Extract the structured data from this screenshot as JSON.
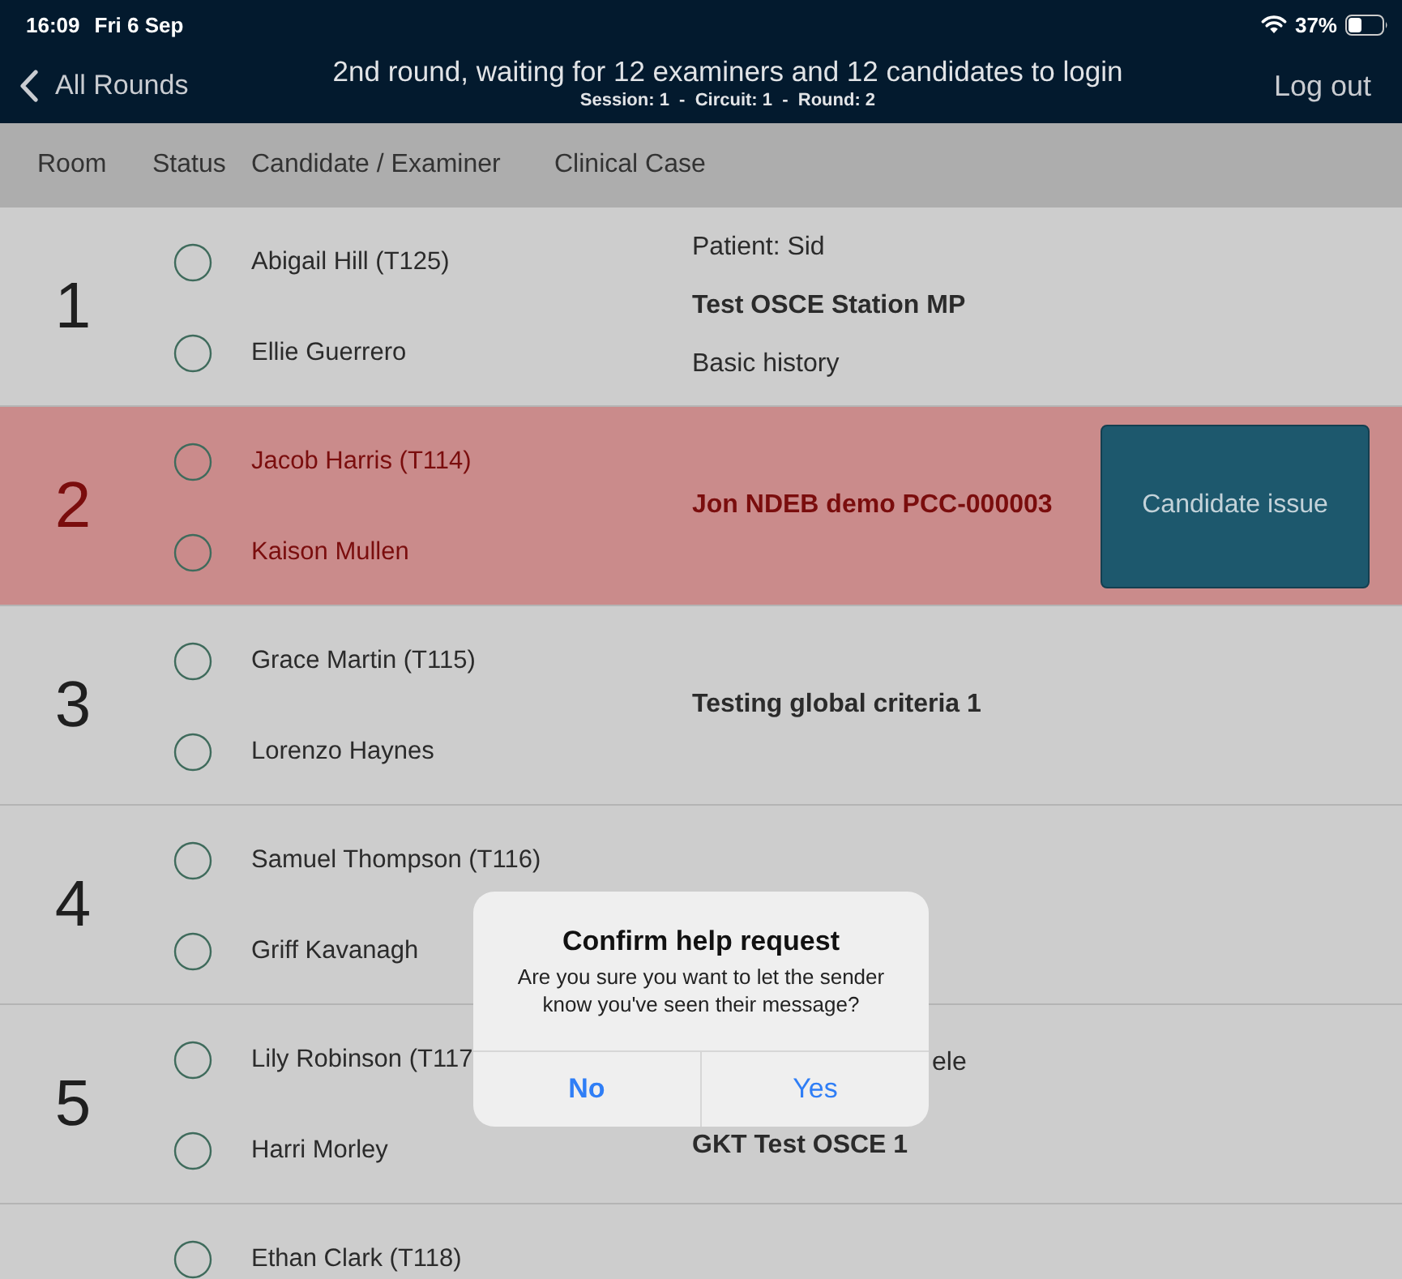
{
  "status_bar": {
    "time": "16:09",
    "date": "Fri 6 Sep",
    "battery": "37%"
  },
  "nav_bar": {
    "back": "All Rounds",
    "title": "2nd round, waiting for 12 examiners and 12 candidates to login",
    "subtitle": "Session: 1  -  Circuit: 1  -  Round: 2",
    "action": "Log out"
  },
  "table": {
    "columns": [
      "Room",
      "Status",
      "Candidate / Examiner",
      "Clinical Case"
    ],
    "rows": [
      {
        "room": "1",
        "alert": false,
        "people": [
          {
            "name": "Abigail Hill (T125)",
            "logged_in": false
          },
          {
            "name": "Ellie Guerrero",
            "logged_in": false
          }
        ],
        "case": [
          {
            "kind": "plain",
            "text": "Patient: Sid"
          },
          {
            "kind": "title",
            "text": "Test OSCE Station MP"
          },
          {
            "kind": "plain",
            "text": "Basic history"
          }
        ]
      },
      {
        "room": "2",
        "alert": true,
        "people": [
          {
            "name": "Jacob Harris (T114)",
            "logged_in": false
          },
          {
            "name": "Kaison Mullen",
            "logged_in": false
          }
        ],
        "case": [
          {
            "kind": "title",
            "text": "Jon NDEB demo PCC-000003"
          }
        ],
        "action": "Candidate issue"
      },
      {
        "room": "3",
        "alert": false,
        "people": [
          {
            "name": "Grace Martin (T115)",
            "logged_in": false
          },
          {
            "name": "Lorenzo Haynes",
            "logged_in": false
          }
        ],
        "case": [
          {
            "kind": "title",
            "text": "Testing global criteria 1"
          }
        ]
      },
      {
        "room": "4",
        "alert": false,
        "people": [
          {
            "name": "Samuel Thompson (T116)",
            "logged_in": false
          },
          {
            "name": "Griff Kavanagh",
            "logged_in": false
          }
        ]
      },
      {
        "room": "5",
        "alert": false,
        "people": [
          {
            "name": "Lily Robinson (T117",
            "logged_in": false
          },
          {
            "name": "Harri Morley",
            "logged_in": false
          }
        ],
        "case": [
          {
            "kind": "fragment",
            "text": "ele"
          },
          {
            "kind": "title",
            "text": "GKT Test OSCE 1"
          }
        ]
      },
      {
        "alert": false,
        "people": [
          {
            "name": "Ethan Clark (T118)",
            "logged_in": false
          }
        ]
      }
    ]
  },
  "dialog": {
    "title": "Confirm help request",
    "message": "Are you sure you want to let the sender know you've seen their message?",
    "buttons": [
      {
        "label": "No",
        "preferred": true
      },
      {
        "label": "Yes",
        "preferred": false
      }
    ]
  }
}
